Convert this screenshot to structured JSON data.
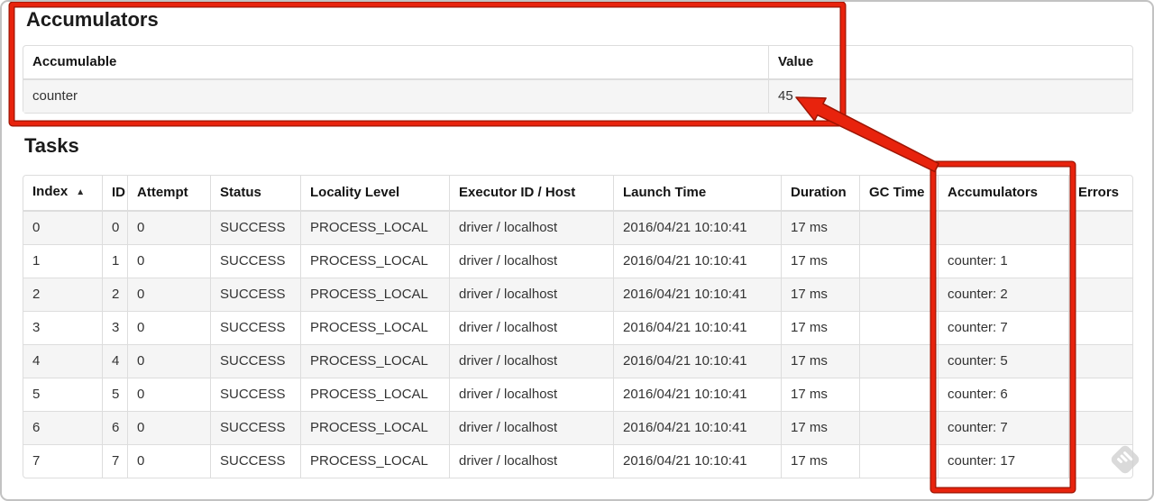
{
  "colors": {
    "annotation_red": "#e8230d",
    "annotation_red_dark": "#9e1504",
    "table_border": "#dddddd",
    "row_stripe": "#f5f5f5",
    "watermark_gray": "#d2d2d2"
  },
  "accumulators_section": {
    "title": "Accumulators",
    "table": {
      "columns": [
        "Accumulable",
        "Value"
      ],
      "rows": [
        {
          "accumulable": "counter",
          "value": "45"
        }
      ]
    }
  },
  "tasks_section": {
    "title": "Tasks",
    "table": {
      "columns": [
        "Index",
        "ID",
        "Attempt",
        "Status",
        "Locality Level",
        "Executor ID / Host",
        "Launch Time",
        "Duration",
        "GC Time",
        "Accumulators",
        "Errors"
      ],
      "sorted_column": "Index",
      "sort_indicator": "▲",
      "rows": [
        {
          "index": "0",
          "id": "0",
          "attempt": "0",
          "status": "SUCCESS",
          "locality_level": "PROCESS_LOCAL",
          "executor_id_host": "driver / localhost",
          "launch_time": "2016/04/21 10:10:41",
          "duration": "17 ms",
          "gc_time": "",
          "accumulators": "",
          "errors": ""
        },
        {
          "index": "1",
          "id": "1",
          "attempt": "0",
          "status": "SUCCESS",
          "locality_level": "PROCESS_LOCAL",
          "executor_id_host": "driver / localhost",
          "launch_time": "2016/04/21 10:10:41",
          "duration": "17 ms",
          "gc_time": "",
          "accumulators": "counter: 1",
          "errors": ""
        },
        {
          "index": "2",
          "id": "2",
          "attempt": "0",
          "status": "SUCCESS",
          "locality_level": "PROCESS_LOCAL",
          "executor_id_host": "driver / localhost",
          "launch_time": "2016/04/21 10:10:41",
          "duration": "17 ms",
          "gc_time": "",
          "accumulators": "counter: 2",
          "errors": ""
        },
        {
          "index": "3",
          "id": "3",
          "attempt": "0",
          "status": "SUCCESS",
          "locality_level": "PROCESS_LOCAL",
          "executor_id_host": "driver / localhost",
          "launch_time": "2016/04/21 10:10:41",
          "duration": "17 ms",
          "gc_time": "",
          "accumulators": "counter: 7",
          "errors": ""
        },
        {
          "index": "4",
          "id": "4",
          "attempt": "0",
          "status": "SUCCESS",
          "locality_level": "PROCESS_LOCAL",
          "executor_id_host": "driver / localhost",
          "launch_time": "2016/04/21 10:10:41",
          "duration": "17 ms",
          "gc_time": "",
          "accumulators": "counter: 5",
          "errors": ""
        },
        {
          "index": "5",
          "id": "5",
          "attempt": "0",
          "status": "SUCCESS",
          "locality_level": "PROCESS_LOCAL",
          "executor_id_host": "driver / localhost",
          "launch_time": "2016/04/21 10:10:41",
          "duration": "17 ms",
          "gc_time": "",
          "accumulators": "counter: 6",
          "errors": ""
        },
        {
          "index": "6",
          "id": "6",
          "attempt": "0",
          "status": "SUCCESS",
          "locality_level": "PROCESS_LOCAL",
          "executor_id_host": "driver / localhost",
          "launch_time": "2016/04/21 10:10:41",
          "duration": "17 ms",
          "gc_time": "",
          "accumulators": "counter: 7",
          "errors": ""
        },
        {
          "index": "7",
          "id": "7",
          "attempt": "0",
          "status": "SUCCESS",
          "locality_level": "PROCESS_LOCAL",
          "executor_id_host": "driver / localhost",
          "launch_time": "2016/04/21 10:10:41",
          "duration": "17 ms",
          "gc_time": "",
          "accumulators": "counter: 17",
          "errors": ""
        }
      ]
    }
  },
  "annotations": {
    "box_1_target": "accumulators-summary",
    "box_2_target": "accumulators-column",
    "arrow_points_to": "45"
  },
  "watermark": {
    "icon": "watermark-diamond-icon"
  }
}
